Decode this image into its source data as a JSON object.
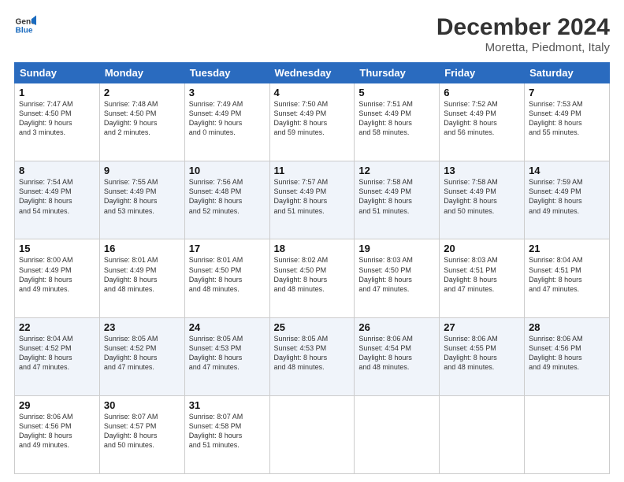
{
  "logo": {
    "line1": "General",
    "line2": "Blue"
  },
  "title": "December 2024",
  "subtitle": "Moretta, Piedmont, Italy",
  "header_days": [
    "Sunday",
    "Monday",
    "Tuesday",
    "Wednesday",
    "Thursday",
    "Friday",
    "Saturday"
  ],
  "weeks": [
    [
      {
        "day": "1",
        "info": "Sunrise: 7:47 AM\nSunset: 4:50 PM\nDaylight: 9 hours\nand 3 minutes."
      },
      {
        "day": "2",
        "info": "Sunrise: 7:48 AM\nSunset: 4:50 PM\nDaylight: 9 hours\nand 2 minutes."
      },
      {
        "day": "3",
        "info": "Sunrise: 7:49 AM\nSunset: 4:49 PM\nDaylight: 9 hours\nand 0 minutes."
      },
      {
        "day": "4",
        "info": "Sunrise: 7:50 AM\nSunset: 4:49 PM\nDaylight: 8 hours\nand 59 minutes."
      },
      {
        "day": "5",
        "info": "Sunrise: 7:51 AM\nSunset: 4:49 PM\nDaylight: 8 hours\nand 58 minutes."
      },
      {
        "day": "6",
        "info": "Sunrise: 7:52 AM\nSunset: 4:49 PM\nDaylight: 8 hours\nand 56 minutes."
      },
      {
        "day": "7",
        "info": "Sunrise: 7:53 AM\nSunset: 4:49 PM\nDaylight: 8 hours\nand 55 minutes."
      }
    ],
    [
      {
        "day": "8",
        "info": "Sunrise: 7:54 AM\nSunset: 4:49 PM\nDaylight: 8 hours\nand 54 minutes."
      },
      {
        "day": "9",
        "info": "Sunrise: 7:55 AM\nSunset: 4:49 PM\nDaylight: 8 hours\nand 53 minutes."
      },
      {
        "day": "10",
        "info": "Sunrise: 7:56 AM\nSunset: 4:48 PM\nDaylight: 8 hours\nand 52 minutes."
      },
      {
        "day": "11",
        "info": "Sunrise: 7:57 AM\nSunset: 4:49 PM\nDaylight: 8 hours\nand 51 minutes."
      },
      {
        "day": "12",
        "info": "Sunrise: 7:58 AM\nSunset: 4:49 PM\nDaylight: 8 hours\nand 51 minutes."
      },
      {
        "day": "13",
        "info": "Sunrise: 7:58 AM\nSunset: 4:49 PM\nDaylight: 8 hours\nand 50 minutes."
      },
      {
        "day": "14",
        "info": "Sunrise: 7:59 AM\nSunset: 4:49 PM\nDaylight: 8 hours\nand 49 minutes."
      }
    ],
    [
      {
        "day": "15",
        "info": "Sunrise: 8:00 AM\nSunset: 4:49 PM\nDaylight: 8 hours\nand 49 minutes."
      },
      {
        "day": "16",
        "info": "Sunrise: 8:01 AM\nSunset: 4:49 PM\nDaylight: 8 hours\nand 48 minutes."
      },
      {
        "day": "17",
        "info": "Sunrise: 8:01 AM\nSunset: 4:50 PM\nDaylight: 8 hours\nand 48 minutes."
      },
      {
        "day": "18",
        "info": "Sunrise: 8:02 AM\nSunset: 4:50 PM\nDaylight: 8 hours\nand 48 minutes."
      },
      {
        "day": "19",
        "info": "Sunrise: 8:03 AM\nSunset: 4:50 PM\nDaylight: 8 hours\nand 47 minutes."
      },
      {
        "day": "20",
        "info": "Sunrise: 8:03 AM\nSunset: 4:51 PM\nDaylight: 8 hours\nand 47 minutes."
      },
      {
        "day": "21",
        "info": "Sunrise: 8:04 AM\nSunset: 4:51 PM\nDaylight: 8 hours\nand 47 minutes."
      }
    ],
    [
      {
        "day": "22",
        "info": "Sunrise: 8:04 AM\nSunset: 4:52 PM\nDaylight: 8 hours\nand 47 minutes."
      },
      {
        "day": "23",
        "info": "Sunrise: 8:05 AM\nSunset: 4:52 PM\nDaylight: 8 hours\nand 47 minutes."
      },
      {
        "day": "24",
        "info": "Sunrise: 8:05 AM\nSunset: 4:53 PM\nDaylight: 8 hours\nand 47 minutes."
      },
      {
        "day": "25",
        "info": "Sunrise: 8:05 AM\nSunset: 4:53 PM\nDaylight: 8 hours\nand 48 minutes."
      },
      {
        "day": "26",
        "info": "Sunrise: 8:06 AM\nSunset: 4:54 PM\nDaylight: 8 hours\nand 48 minutes."
      },
      {
        "day": "27",
        "info": "Sunrise: 8:06 AM\nSunset: 4:55 PM\nDaylight: 8 hours\nand 48 minutes."
      },
      {
        "day": "28",
        "info": "Sunrise: 8:06 AM\nSunset: 4:56 PM\nDaylight: 8 hours\nand 49 minutes."
      }
    ],
    [
      {
        "day": "29",
        "info": "Sunrise: 8:06 AM\nSunset: 4:56 PM\nDaylight: 8 hours\nand 49 minutes."
      },
      {
        "day": "30",
        "info": "Sunrise: 8:07 AM\nSunset: 4:57 PM\nDaylight: 8 hours\nand 50 minutes."
      },
      {
        "day": "31",
        "info": "Sunrise: 8:07 AM\nSunset: 4:58 PM\nDaylight: 8 hours\nand 51 minutes."
      },
      null,
      null,
      null,
      null
    ]
  ]
}
